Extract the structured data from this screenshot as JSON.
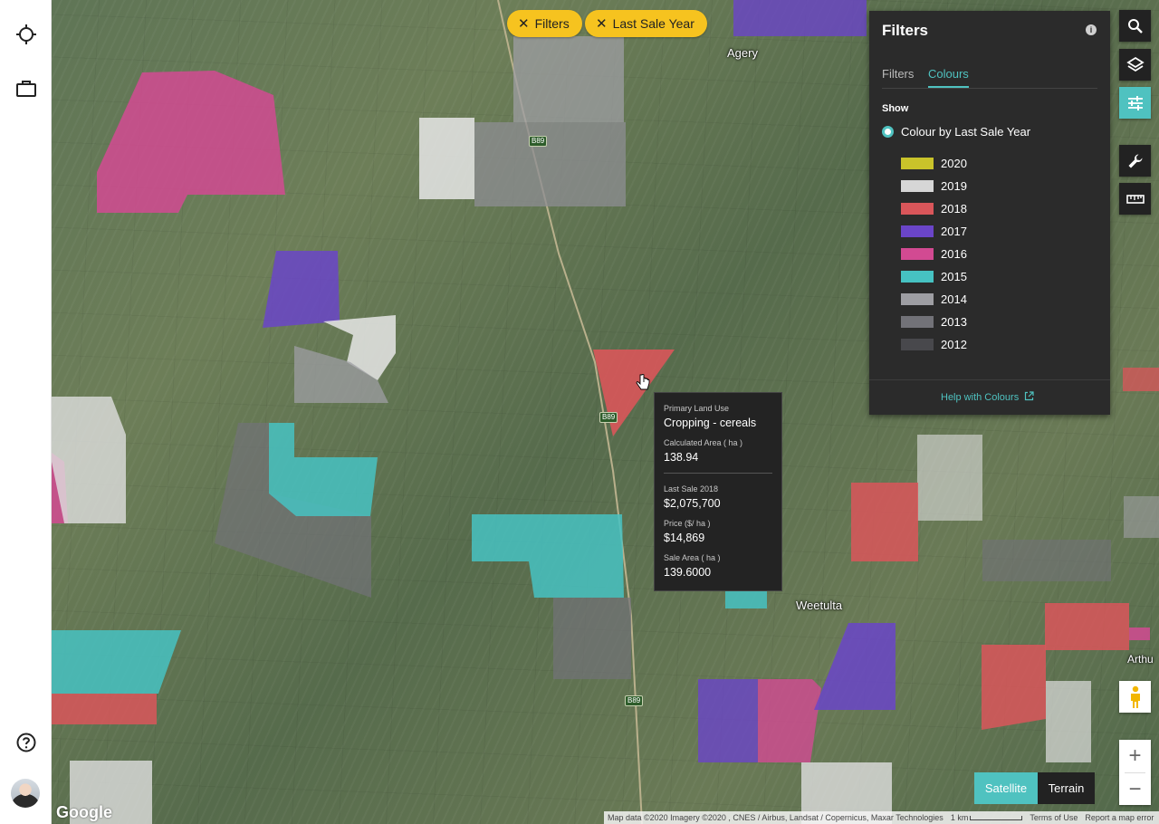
{
  "rail": {
    "locate_icon": "crosshair-icon",
    "portfolio_icon": "briefcase-icon",
    "help_icon": "help-circle-icon"
  },
  "chips": [
    {
      "label": "Filters"
    },
    {
      "label": "Last Sale Year"
    }
  ],
  "map_labels": {
    "town_agery": "Agery",
    "town_weetulta": "Weetulta",
    "town_arthurton": "Arthu",
    "road": "B89"
  },
  "tooltip": {
    "land_use_key": "Primary Land Use",
    "land_use_value": "Cropping - cereals",
    "area_key": "Calculated Area ( ha )",
    "area_value": "138.94",
    "sale_key": "Last Sale 2018",
    "sale_value": "$2,075,700",
    "price_key": "Price ($/ ha )",
    "price_value": "$14,869",
    "sale_area_key": "Sale Area ( ha )",
    "sale_area_value": "139.6000"
  },
  "panel": {
    "title": "Filters",
    "tabs": [
      {
        "label": "Filters",
        "active": false
      },
      {
        "label": "Colours",
        "active": true
      }
    ],
    "show_label": "Show",
    "radio_label": "Colour by Last Sale Year",
    "legend": [
      {
        "year": "2020",
        "color": "#c9c32a"
      },
      {
        "year": "2019",
        "color": "#d6d6d6"
      },
      {
        "year": "2018",
        "color": "#d9565a"
      },
      {
        "year": "2017",
        "color": "#6a45c8"
      },
      {
        "year": "2016",
        "color": "#d24a92"
      },
      {
        "year": "2015",
        "color": "#46c2c2"
      },
      {
        "year": "2014",
        "color": "#9e9ea3"
      },
      {
        "year": "2013",
        "color": "#727278"
      },
      {
        "year": "2012",
        "color": "#48484c"
      }
    ],
    "help_link": "Help with Colours"
  },
  "toolbar": {
    "search_icon": "search-icon",
    "layers_icon": "layers-icon",
    "filters_icon": "sliders-icon",
    "tools_icon": "wrench-icon",
    "measure_icon": "ruler-icon"
  },
  "map_controls": {
    "zoom_in": "+",
    "zoom_out": "−",
    "map_types": [
      {
        "label": "Satellite",
        "active": true
      },
      {
        "label": "Terrain",
        "active": false
      }
    ]
  },
  "attribution": {
    "google": "Google",
    "data": "Map data ©2020 Imagery ©2020 , CNES / Airbus, Landsat / Copernicus, Maxar Technologies",
    "scale": "1 km",
    "terms": "Terms of Use",
    "report": "Report a map error"
  },
  "colors": {
    "accent": "#4fc2c0",
    "chip": "#f6c31f",
    "panel_bg": "#2b2b2b"
  }
}
